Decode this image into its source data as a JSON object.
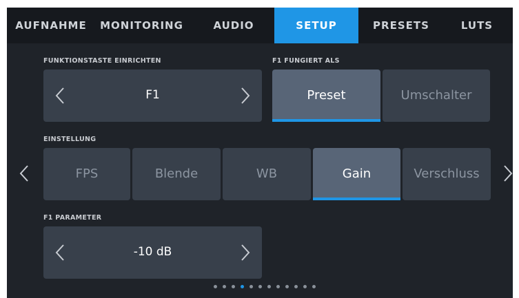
{
  "tabs": [
    {
      "label": "AUFNAHME",
      "active": false
    },
    {
      "label": "MONITORING",
      "active": false
    },
    {
      "label": "AUDIO",
      "active": false
    },
    {
      "label": "SETUP",
      "active": true
    },
    {
      "label": "PRESETS",
      "active": false
    },
    {
      "label": "LUTS",
      "active": false
    }
  ],
  "function_key": {
    "label": "FUNKTIONSTASTE EINRICHTEN",
    "value": "F1"
  },
  "f1_acts_as": {
    "label": "F1 FUNGIERT ALS",
    "options": [
      "Preset",
      "Umschalter"
    ],
    "selected": "Preset"
  },
  "setting": {
    "label": "EINSTELLUNG",
    "options": [
      "FPS",
      "Blende",
      "WB",
      "Gain",
      "Verschluss"
    ],
    "selected": "Gain"
  },
  "f1_parameter": {
    "label": "F1 PARAMETER",
    "value": "-10 dB"
  },
  "pagination": {
    "count": 12,
    "active_index": 3
  },
  "colors": {
    "accent": "#1f96e6",
    "background": "#1f2329",
    "tile": "#38404b",
    "tile_selected": "#586577"
  }
}
